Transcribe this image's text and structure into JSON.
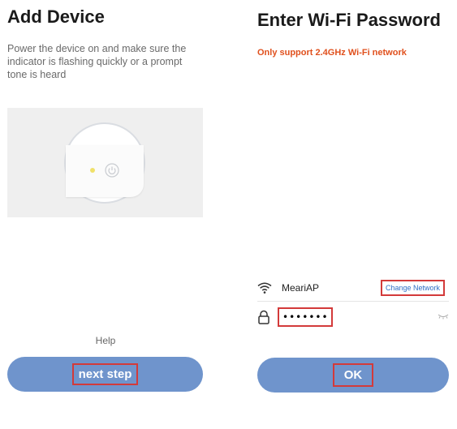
{
  "left": {
    "title": "Add Device",
    "description": "Power the device on and make sure the indicator is flashing quickly or a prompt tone is heard",
    "help_label": "Help",
    "next_label": "next step",
    "icons": [
      "power-icon",
      "led-indicator"
    ]
  },
  "right": {
    "title": "Enter Wi-Fi Password",
    "warning": "Only support 2.4GHz Wi-Fi network",
    "ssid": "MeariAP",
    "change_network_label": "Change Network",
    "password_value": "••••••••",
    "ok_label": "OK",
    "icons": [
      "wifi-icon",
      "lock-icon",
      "eye-closed-icon"
    ]
  },
  "colors": {
    "button": "#6f94cc",
    "warning": "#e0501d",
    "link": "#2f6fc5",
    "highlight": "#d33a3a"
  }
}
